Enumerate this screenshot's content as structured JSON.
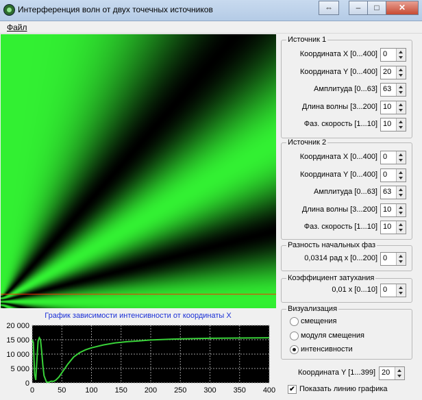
{
  "window": {
    "title": "Интерференция волн от двух точечных источников"
  },
  "window_controls": {
    "restore": "⇔",
    "minimize": "–",
    "maximize": "□",
    "close": "✕"
  },
  "menu": {
    "file": "Файл"
  },
  "plot": {
    "title": "График зависимости интенсивности от координаты X"
  },
  "chart_data": {
    "type": "line",
    "title": "График зависимости интенсивности от координаты X",
    "xlim": [
      0,
      400
    ],
    "ylim": [
      0,
      20000
    ],
    "x_ticks": [
      "0",
      "50",
      "100",
      "150",
      "200",
      "250",
      "300",
      "350",
      "400"
    ],
    "y_ticks": [
      "0",
      "5 000",
      "10 000",
      "15 000",
      "20 000"
    ],
    "grid": true,
    "series": [
      {
        "color": "#39d239",
        "x": [
          0,
          2,
          4,
          6,
          8,
          10,
          12,
          14,
          16,
          18,
          20,
          24,
          28,
          32,
          36,
          40,
          45,
          50,
          60,
          70,
          80,
          90,
          100,
          120,
          140,
          160,
          180,
          200,
          250,
          300,
          350,
          400
        ],
        "y": [
          15000,
          14000,
          3000,
          1000,
          8000,
          14500,
          15700,
          15000,
          11000,
          6000,
          2500,
          300,
          200,
          600,
          500,
          1000,
          2000,
          3500,
          6500,
          9000,
          10500,
          11500,
          12200,
          13200,
          13900,
          14300,
          14600,
          14900,
          15300,
          15500,
          15600,
          15700
        ]
      }
    ]
  },
  "source1": {
    "title": "Источник 1",
    "rows": [
      {
        "label": "Координата X [0...400]",
        "value": "0"
      },
      {
        "label": "Координата Y [0...400]",
        "value": "20"
      },
      {
        "label": "Амплитуда [0...63]",
        "value": "63"
      },
      {
        "label": "Длина волны [3...200]",
        "value": "10"
      },
      {
        "label": "Фаз. скорость [1...10]",
        "value": "10"
      }
    ]
  },
  "source2": {
    "title": "Источник 2",
    "rows": [
      {
        "label": "Координата X [0...400]",
        "value": "0"
      },
      {
        "label": "Координата Y [0...400]",
        "value": "0"
      },
      {
        "label": "Амплитуда [0...63]",
        "value": "63"
      },
      {
        "label": "Длина волны [3...200]",
        "value": "10"
      },
      {
        "label": "Фаз. скорость [1...10]",
        "value": "10"
      }
    ]
  },
  "phase": {
    "title": "Разность начальных фаз",
    "label": "0,0314 рад  x  [0...200]",
    "value": "0"
  },
  "damping": {
    "title": "Коэффициент затухания",
    "label": "0,01  x  [0...10]",
    "value": "0"
  },
  "visual": {
    "title": "Визуализация",
    "options": [
      "смещения",
      "модуля смещения",
      "интенсивности"
    ],
    "selected": 2
  },
  "ycoord": {
    "label": "Координата Y [1...399]",
    "value": "20"
  },
  "show_line": {
    "label": "Показать линию графика",
    "checked": true,
    "mark": "✔"
  },
  "colors": {
    "field": "#33ee33",
    "line": "#ff2a00",
    "plot_line": "#39d239"
  }
}
